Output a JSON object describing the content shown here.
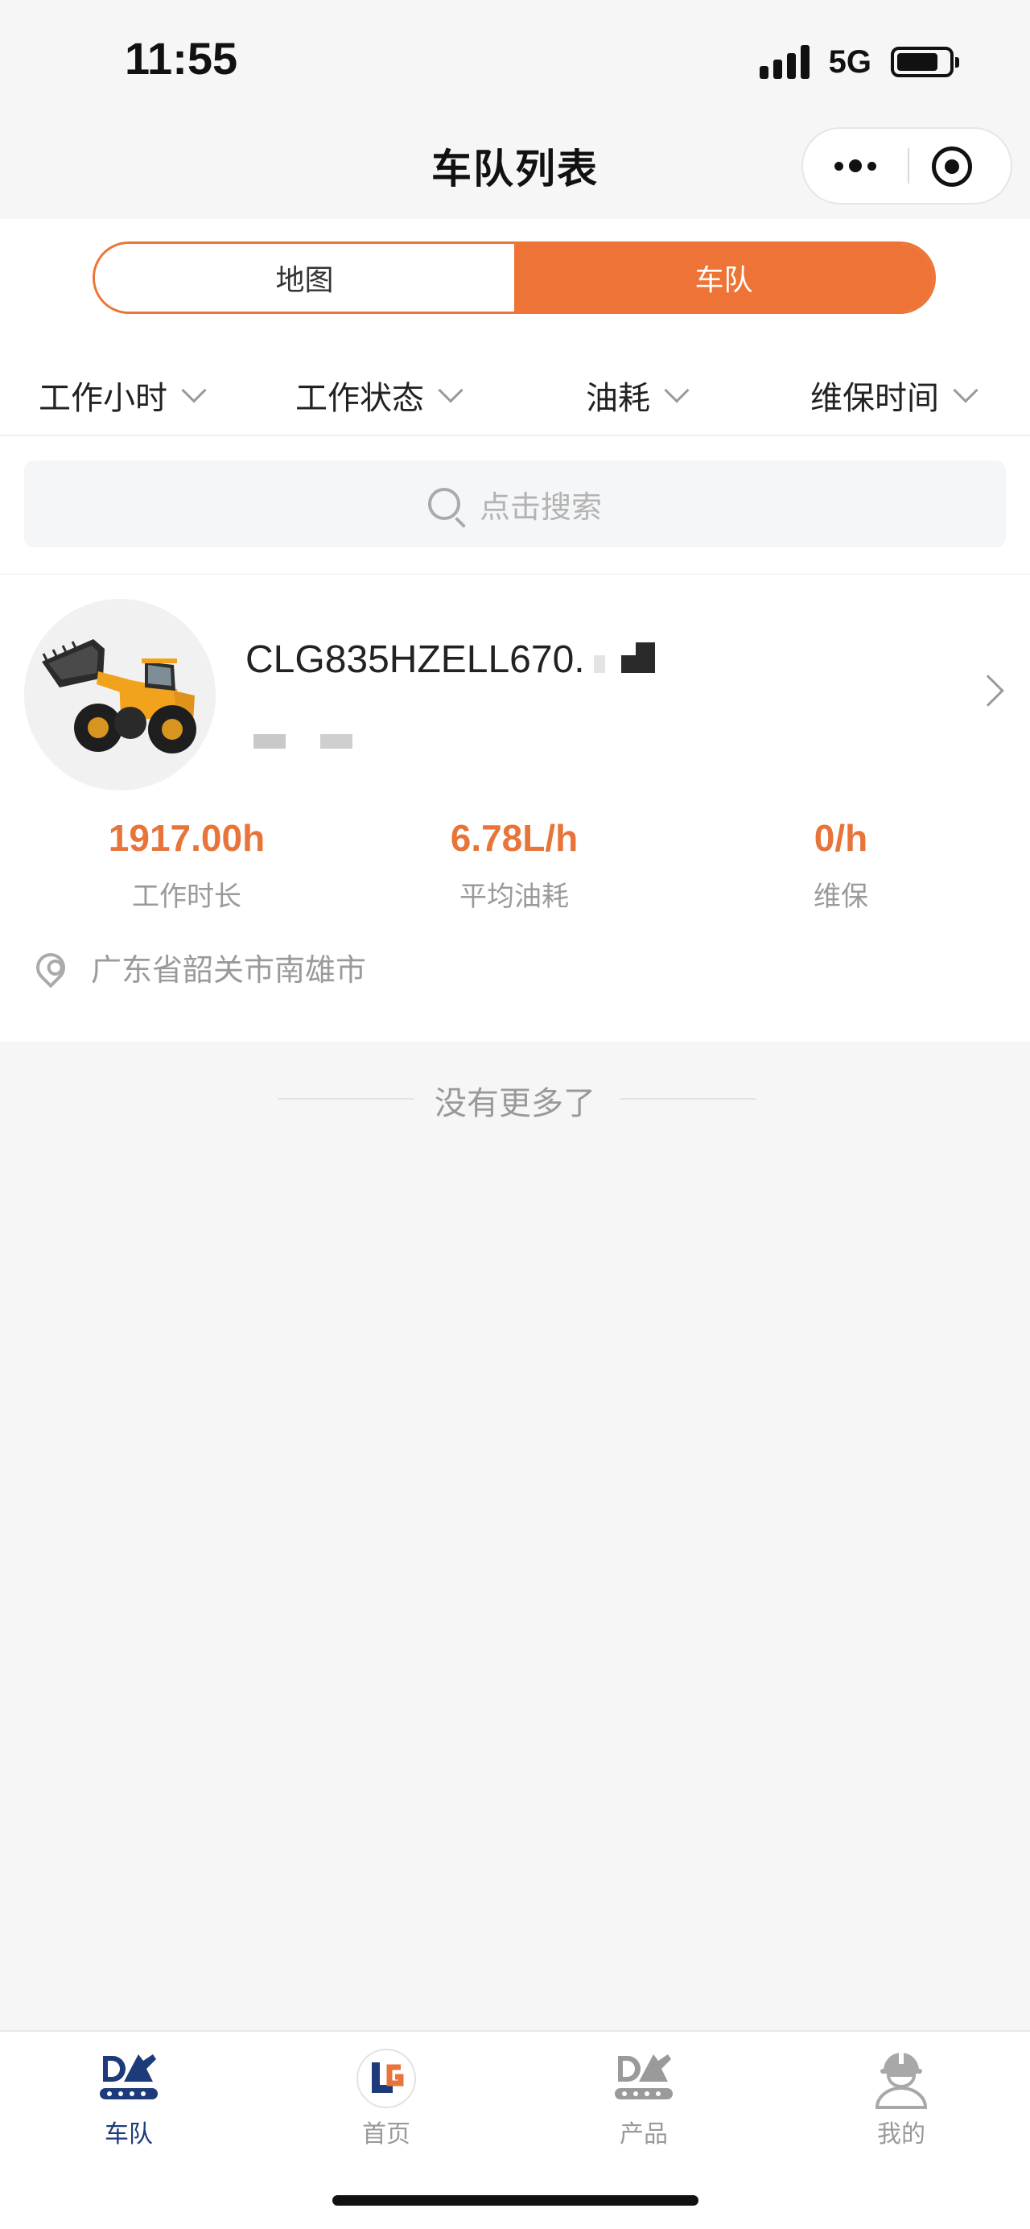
{
  "status_bar": {
    "time": "11:55",
    "network": "5G"
  },
  "nav": {
    "title": "车队列表"
  },
  "segments": [
    {
      "label": "地图",
      "active": false
    },
    {
      "label": "车队",
      "active": true
    }
  ],
  "filters": [
    {
      "label": "工作小时"
    },
    {
      "label": "工作状态"
    },
    {
      "label": "油耗"
    },
    {
      "label": "维保时间"
    }
  ],
  "search": {
    "placeholder": "点击搜索"
  },
  "vehicle": {
    "name": "CLG835HZELL670.",
    "stats": [
      {
        "value": "1917.00h",
        "label": "工作时长"
      },
      {
        "value": "6.78L/h",
        "label": "平均油耗"
      },
      {
        "value": "0/h",
        "label": "维保"
      }
    ],
    "location": "广东省韶关市南雄市"
  },
  "list_end_text": "没有更多了",
  "tabbar": [
    {
      "label": "车队",
      "icon": "fleet-icon",
      "active": true
    },
    {
      "label": "首页",
      "icon": "home-logo-icon",
      "active": false
    },
    {
      "label": "产品",
      "icon": "product-excavator-icon",
      "active": false
    },
    {
      "label": "我的",
      "icon": "profile-worker-icon",
      "active": false
    }
  ],
  "colors": {
    "accent": "#ee7336",
    "stat_orange": "#e8743a",
    "tab_active": "#1d3a7a"
  }
}
